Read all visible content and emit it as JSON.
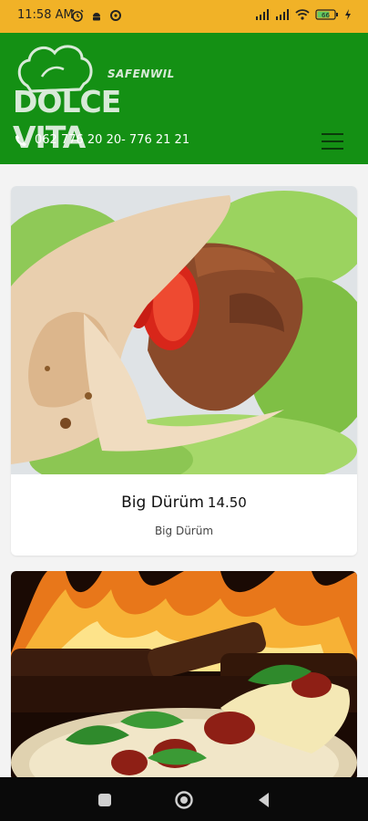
{
  "status_bar": {
    "time": "11:58 AM",
    "battery": "66"
  },
  "header": {
    "logo_sub": "SAFENWIL",
    "logo_main": "DOLCE VITA",
    "phone": "062 776 20 20- 776 21 21"
  },
  "menu_items": [
    {
      "name": "Big Dürüm",
      "price": "14.50",
      "description": "Big Dürüm"
    }
  ],
  "colors": {
    "status_bar": "#f1b227",
    "header": "#149014",
    "nav_bar": "#0a0a0a"
  },
  "icons": {
    "status_left": [
      "alarm-icon",
      "android-icon",
      "settings-icon"
    ],
    "status_right": [
      "signal-icon",
      "signal-icon",
      "wifi-icon",
      "battery-icon",
      "charging-icon"
    ],
    "phone": "phone-icon",
    "menu": "hamburger-menu-icon",
    "nav": [
      "recents-icon",
      "home-icon",
      "back-icon"
    ]
  }
}
